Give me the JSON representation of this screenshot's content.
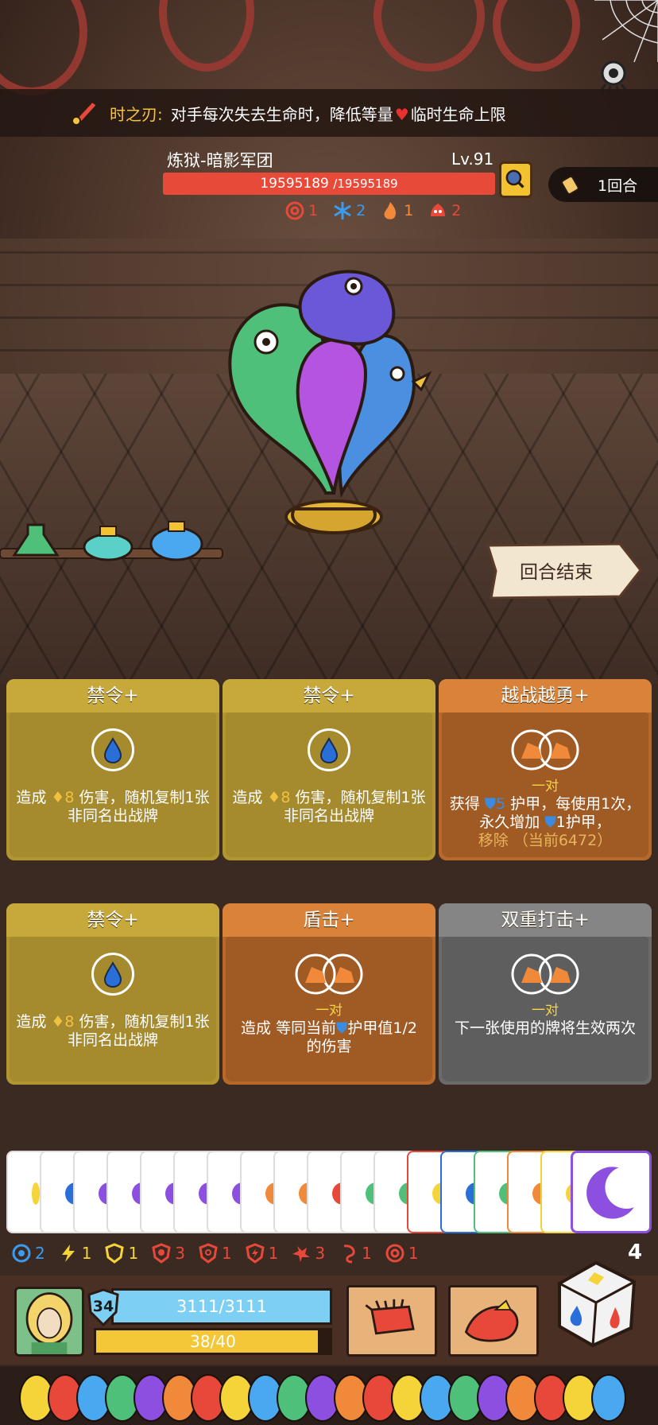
{
  "relic_banner": {
    "name": "时之刃:",
    "desc_before": "对手每次失去生命时，降低等量",
    "desc_after": "临时生命上限",
    "icon": "blade-relic-icon"
  },
  "enemy": {
    "name": "炼狱-暗影军团",
    "level": "Lv.91",
    "hp_current": "19595189",
    "hp_max": "/19595189",
    "statuses": [
      {
        "icon": "spiral-icon",
        "value": "1",
        "color": "#e8483a"
      },
      {
        "icon": "snowflake-icon",
        "value": "2",
        "color": "#3a9cf0"
      },
      {
        "icon": "flame-icon",
        "value": "1",
        "color": "#f08a3a"
      },
      {
        "icon": "rage-icon",
        "value": "2",
        "color": "#e8483a"
      }
    ]
  },
  "turn": {
    "label": "1回合"
  },
  "end_turn": {
    "label": "回合结束"
  },
  "cards": [
    {
      "title": "禁令+",
      "type": "gold",
      "text_before": "造成 ",
      "num": "8",
      "text_after": " 伤害，随机复制1张非同名出战牌"
    },
    {
      "title": "禁令+",
      "type": "gold",
      "text_before": "造成 ",
      "num": "8",
      "text_after": " 伤害，随机复制1张非同名出战牌"
    },
    {
      "title": "越战越勇+",
      "type": "orange",
      "pair": "一对",
      "t1": "获得 ",
      "n1": "5",
      "t2": " 护甲，每使用1次，永久增加 ",
      "n2": "1",
      "t3": "护甲，",
      "dim": "移除 （当前6472）"
    },
    {
      "title": "禁令+",
      "type": "gold",
      "text_before": "造成 ",
      "num": "8",
      "text_after": " 伤害，随机复制1张非同名出战牌"
    },
    {
      "title": "盾击+",
      "type": "orange",
      "pair": "一对",
      "t1": "造成 等同当前",
      "t2": "护甲值1/2 的伤害"
    },
    {
      "title": "双重打击+",
      "type": "gray",
      "pair": "一对",
      "t1": "下一张使用的牌将生效两次"
    }
  ],
  "buffs": [
    {
      "icon": "focus-icon",
      "value": "2",
      "color": "#3a9cf0"
    },
    {
      "icon": "lightning-icon",
      "value": "1",
      "color": "#f5d43a"
    },
    {
      "icon": "shield-buff-icon",
      "value": "1",
      "color": "#f5d43a"
    },
    {
      "icon": "heart-shield-icon",
      "value": "3",
      "color": "#e8483a"
    },
    {
      "icon": "target-shield-icon",
      "value": "1",
      "color": "#e8483a"
    },
    {
      "icon": "bolt-shield-icon",
      "value": "1",
      "color": "#e8483a"
    },
    {
      "icon": "claw-icon",
      "value": "3",
      "color": "#e8483a"
    },
    {
      "icon": "hook-icon",
      "value": "1",
      "color": "#e8483a"
    },
    {
      "icon": "spiral-icon",
      "value": "1",
      "color": "#e8483a"
    }
  ],
  "dice_count": "4",
  "player": {
    "armor": "34",
    "hp": "3111/3111",
    "energy": "38/40",
    "energy_fraction": 0.95
  }
}
